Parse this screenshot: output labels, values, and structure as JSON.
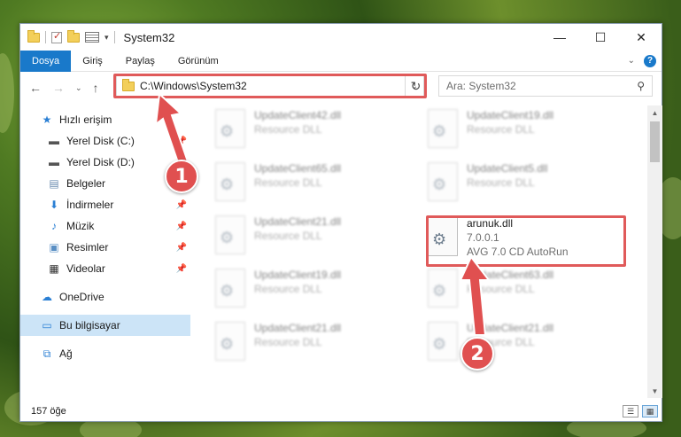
{
  "window": {
    "title": "System32"
  },
  "ribbon": {
    "tabs": [
      "Dosya",
      "Giriş",
      "Paylaş",
      "Görünüm"
    ]
  },
  "address": {
    "path": "C:\\Windows\\System32"
  },
  "search": {
    "placeholder": "Ara: System32"
  },
  "sidebar": {
    "items": [
      {
        "label": "Hızlı erişim",
        "icon": "star-icon"
      },
      {
        "label": "Yerel Disk (C:)",
        "icon": "drive-icon"
      },
      {
        "label": "Yerel Disk (D:)",
        "icon": "drive-icon"
      },
      {
        "label": "Belgeler",
        "icon": "document-icon"
      },
      {
        "label": "İndirmeler",
        "icon": "download-icon"
      },
      {
        "label": "Müzik",
        "icon": "music-icon"
      },
      {
        "label": "Resimler",
        "icon": "picture-icon"
      },
      {
        "label": "Videolar",
        "icon": "video-icon"
      },
      {
        "label": "OneDrive",
        "icon": "cloud-icon"
      },
      {
        "label": "Bu bilgisayar",
        "icon": "computer-icon"
      },
      {
        "label": "Ağ",
        "icon": "network-icon"
      }
    ]
  },
  "files": [
    {
      "name": "UpdateClient42.dll",
      "sub1": "Resource DLL",
      "sub2": ""
    },
    {
      "name": "UpdateClient19.dll",
      "sub1": "Resource DLL",
      "sub2": ""
    },
    {
      "name": "UpdateClient65.dll",
      "sub1": "Resource DLL",
      "sub2": ""
    },
    {
      "name": "UpdateClient5.dll",
      "sub1": "Resource DLL",
      "sub2": ""
    },
    {
      "name": "UpdateClient21.dll",
      "sub1": "Resource DLL",
      "sub2": ""
    },
    {
      "name": "arunuk.dll",
      "sub1": "7.0.0.1",
      "sub2": "AVG 7.0 CD AutoRun"
    },
    {
      "name": "UpdateClient19.dll",
      "sub1": "Resource DLL",
      "sub2": ""
    },
    {
      "name": "UpdateClient63.dll",
      "sub1": "Resource DLL",
      "sub2": ""
    },
    {
      "name": "UpdateClient21.dll",
      "sub1": "Resource DLL",
      "sub2": ""
    },
    {
      "name": "UpdateClient21.dll",
      "sub1": "Resource DLL",
      "sub2": ""
    }
  ],
  "status": {
    "count": "157 öğe"
  },
  "annotations": {
    "badge1": "1",
    "badge2": "2"
  },
  "colors": {
    "accent": "#1979ca",
    "highlight": "#e05a5a",
    "selected": "#cce4f7"
  }
}
